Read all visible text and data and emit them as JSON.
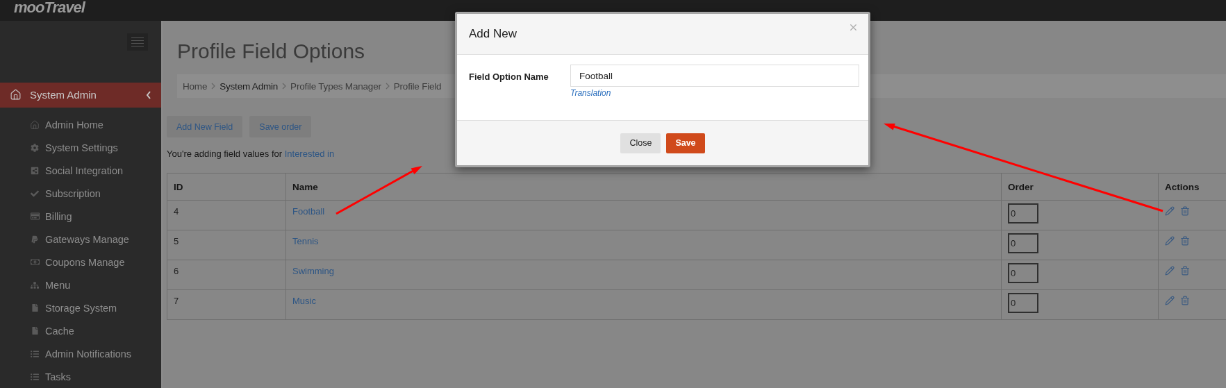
{
  "brand": "mooTravel",
  "sidebar": {
    "section": {
      "label": "System Admin",
      "selected": true
    },
    "items": [
      {
        "label": "Admin Home",
        "kind": "home"
      },
      {
        "label": "System Settings",
        "kind": "gear"
      },
      {
        "label": "Social Integration",
        "kind": "share"
      },
      {
        "label": "Subscription",
        "kind": "check"
      },
      {
        "label": "Billing",
        "kind": "card"
      },
      {
        "label": "Gateways Manage",
        "kind": "paypal"
      },
      {
        "label": "Coupons Manage",
        "kind": "money"
      },
      {
        "label": "Menu",
        "kind": "sitemap"
      },
      {
        "label": "Storage System",
        "kind": "file"
      },
      {
        "label": "Cache",
        "kind": "file"
      },
      {
        "label": "Admin Notifications",
        "kind": "list"
      },
      {
        "label": "Tasks",
        "kind": "list"
      }
    ]
  },
  "page": {
    "title": "Profile Field Options",
    "breadcrumb": [
      {
        "label": "Home",
        "selected": false
      },
      {
        "label": "System Admin",
        "selected": true
      },
      {
        "label": "Profile Types Manager",
        "selected": false
      },
      {
        "label": "Profile Field",
        "selected": false
      }
    ],
    "buttons": [
      "Add New Field",
      "Save order"
    ],
    "notice": {
      "text": "You're adding field values for ",
      "link": "Interested in"
    }
  },
  "table": {
    "columns": [
      "ID",
      "Name",
      "Order",
      "Actions"
    ],
    "rows": [
      {
        "id": "4",
        "name": "Football",
        "order": "0"
      },
      {
        "id": "5",
        "name": "Tennis",
        "order": "0"
      },
      {
        "id": "6",
        "name": "Swimming",
        "order": "0"
      },
      {
        "id": "7",
        "name": "Music",
        "order": "0"
      }
    ]
  },
  "modal": {
    "title": "Add New",
    "field_label": "Field Option Name",
    "field_value": "Football",
    "link": "Translation",
    "buttons": [
      {
        "label": "Close",
        "kind": "secondary"
      },
      {
        "label": "Save",
        "kind": "primary"
      }
    ]
  }
}
